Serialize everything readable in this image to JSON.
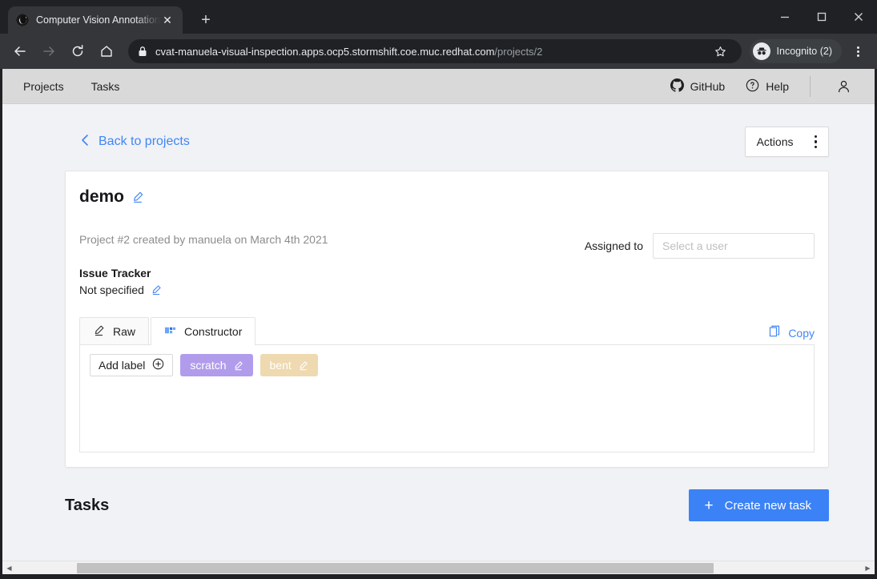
{
  "browser": {
    "tab": {
      "title": "Computer Vision Annotation T",
      "favicon_name": "cvat-logo-icon",
      "close_label": "✕"
    },
    "new_tab_label": "+",
    "window_controls": {
      "minimize": "–",
      "maximize": "□",
      "close": "✕"
    },
    "toolbar": {
      "back_label": "←",
      "forward_label": "→",
      "reload_label": "↻",
      "home_label": "⌂",
      "url_host": "cvat-manuela-visual-inspection.apps.ocp5.stormshift.coe.muc.redhat.com",
      "url_path": "/projects/2",
      "bookmark_label": "☆",
      "profile_label": "Incognito (2)",
      "menu_label": "⋮"
    }
  },
  "app_header": {
    "nav": [
      {
        "label": "Projects"
      },
      {
        "label": "Tasks"
      }
    ],
    "github_label": "GitHub",
    "help_label": "Help",
    "account_icon": "user-icon"
  },
  "page": {
    "back_link": "Back to projects",
    "actions_button": "Actions",
    "project": {
      "name": "demo",
      "created_text": "Project #2 created by manuela on March 4th 2021",
      "assigned_label": "Assigned to",
      "assigned_placeholder": "Select a user",
      "issue_tracker_title": "Issue Tracker",
      "issue_tracker_value": "Not specified"
    },
    "labels_editor": {
      "tabs": [
        {
          "label": "Raw",
          "icon": "pencil-icon",
          "active": false
        },
        {
          "label": "Constructor",
          "icon": "constructor-icon",
          "active": true
        }
      ],
      "copy_label": "Copy",
      "add_label_button": "Add label",
      "labels": [
        {
          "name": "scratch",
          "color": "#b19cec"
        },
        {
          "name": "bent",
          "color": "#eed9b0"
        }
      ]
    },
    "tasks": {
      "heading": "Tasks",
      "create_button": "Create new task",
      "create_button_color": "#3b82f6"
    }
  },
  "colors": {
    "accent_blue": "#4285f4",
    "primary_button": "#3b82f6",
    "page_bg": "#f0f2f5",
    "header_bg": "#d9d9d9",
    "chrome_bg": "#202124"
  }
}
